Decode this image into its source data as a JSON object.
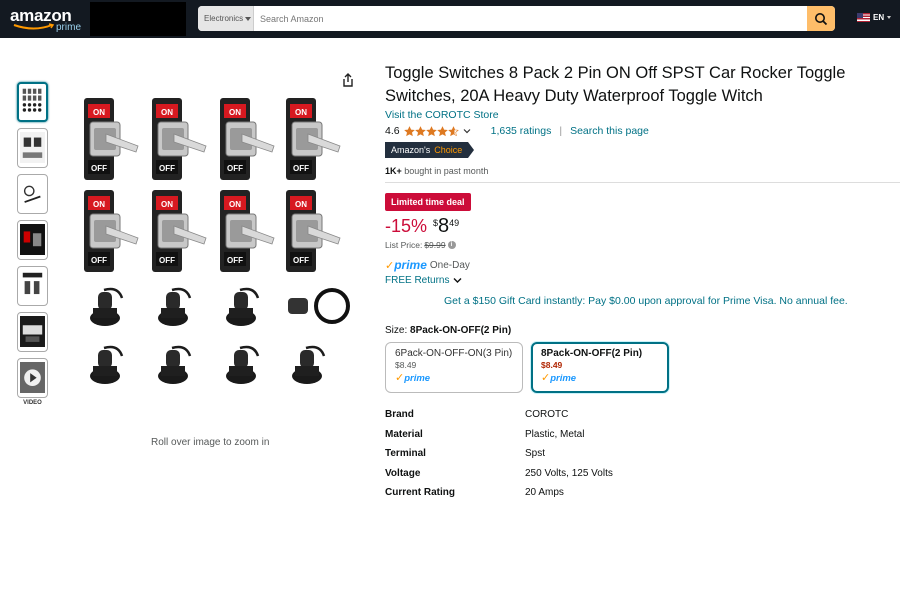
{
  "nav": {
    "logo_text": "amazon",
    "logo_sub": "prime",
    "search_category": "Electronics",
    "search_placeholder": "Search Amazon",
    "language": "EN"
  },
  "gallery": {
    "thumb_count": 7,
    "video_label": "VIDEO",
    "zoom_hint": "Roll over image to zoom in"
  },
  "product": {
    "title": "Toggle Switches 8 Pack 2 Pin ON Off SPST Car Rocker Toggle Switches, 20A Heavy Duty Waterproof Toggle Witch",
    "store_link": "Visit the COROTC Store",
    "rating_value": "4.6",
    "rating_stars": 4.6,
    "ratings_count": "1,635 ratings",
    "search_page": "Search this page",
    "badge_prefix": "Amazon's",
    "badge_choice": "Choice",
    "bought_bold": "1K+",
    "bought_rest": " bought in past month",
    "deal_label": "Limited time deal",
    "discount": "-15%",
    "currency": "$",
    "price_whole": "8",
    "price_fraction": "49",
    "list_price_label": "List Price:",
    "list_price_value": "$9.99",
    "prime_logo": "prime",
    "prime_delivery": "One-Day",
    "free_returns": "FREE Returns",
    "gift_card": "Get a $150 Gift Card instantly: Pay $0.00 upon approval for Prime Visa. No annual fee."
  },
  "size": {
    "label": "Size:",
    "selected": "8Pack-ON-OFF(2 Pin)",
    "options": [
      {
        "name": "6Pack-ON-OFF-ON(3 Pin)",
        "price": "$8.49",
        "prime": "prime"
      },
      {
        "name": "8Pack-ON-OFF(2 Pin)",
        "price": "$8.49",
        "prime": "prime"
      }
    ]
  },
  "specs": [
    {
      "key": "Brand",
      "value": "COROTC"
    },
    {
      "key": "Material",
      "value": "Plastic, Metal"
    },
    {
      "key": "Terminal",
      "value": "Spst"
    },
    {
      "key": "Voltage",
      "value": "250 Volts, 125 Volts"
    },
    {
      "key": "Current Rating",
      "value": "20 Amps"
    }
  ],
  "colors": {
    "nav_bg": "#131921",
    "link": "#007185",
    "deal_red": "#cc0c39",
    "star": "#de7921",
    "search_btn": "#febd69"
  }
}
